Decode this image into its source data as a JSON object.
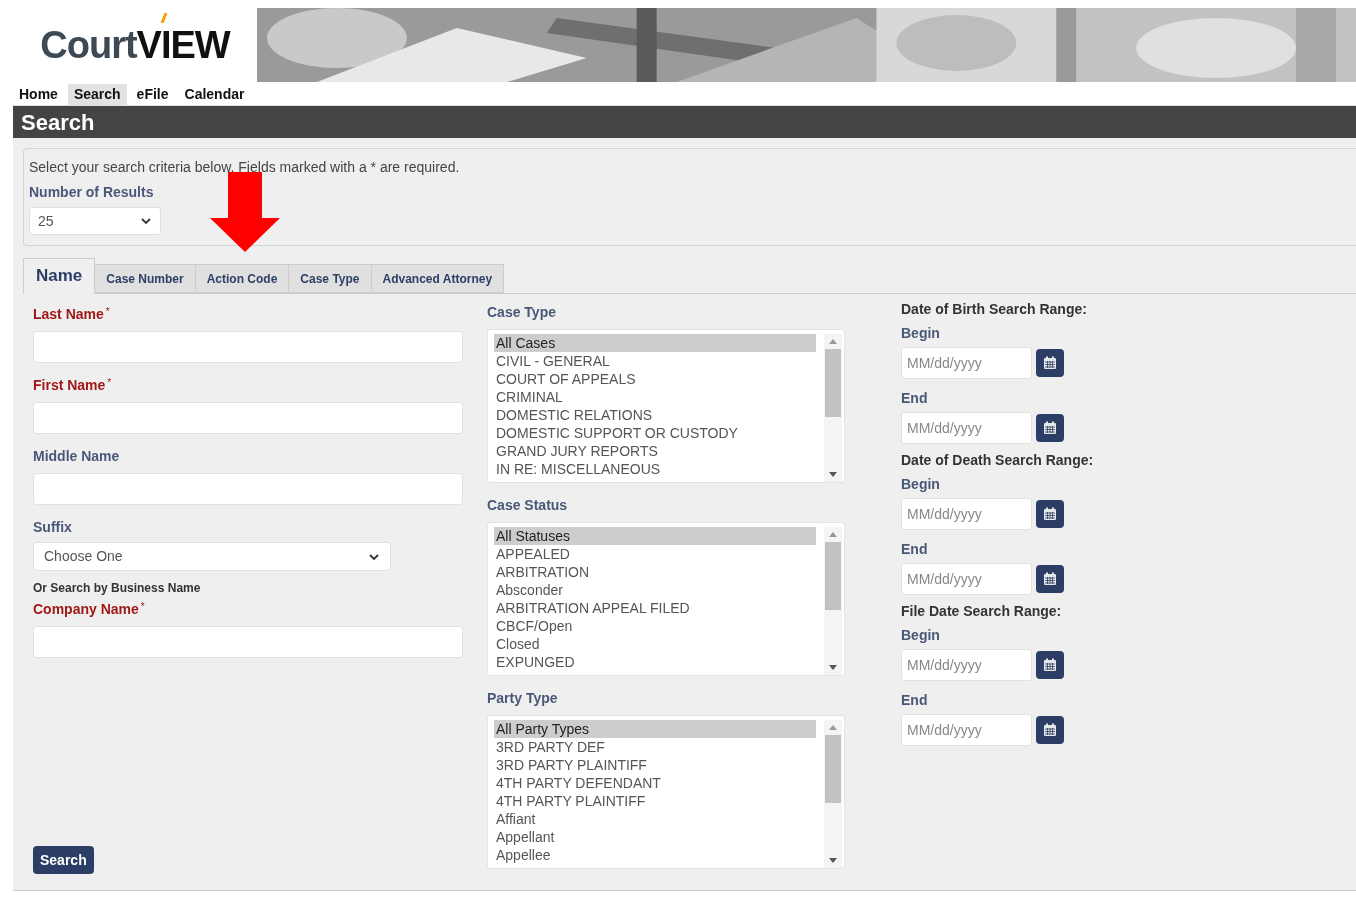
{
  "logo": {
    "text_start": "Court",
    "text_end": "VIEW"
  },
  "nav": [
    {
      "label": "Home",
      "selected": false
    },
    {
      "label": "Search",
      "selected": true
    },
    {
      "label": "eFile",
      "selected": false
    },
    {
      "label": "Calendar",
      "selected": false
    }
  ],
  "page_title": "Search",
  "instructions": "Select your search criteria below. Fields marked with a * are required.",
  "results": {
    "label": "Number of Results",
    "value": "25"
  },
  "tabs": [
    {
      "label": "Name",
      "selected": true
    },
    {
      "label": "Case Number",
      "selected": false
    },
    {
      "label": "Action Code",
      "selected": false
    },
    {
      "label": "Case Type",
      "selected": false
    },
    {
      "label": "Advanced Attorney",
      "selected": false
    }
  ],
  "name_form": [
    {
      "kind": "input",
      "label": "Last Name",
      "required": true,
      "mark": "*"
    },
    {
      "kind": "input",
      "label": "First Name",
      "required": true,
      "mark": "*"
    },
    {
      "kind": "input",
      "label": "Middle Name",
      "required": false
    },
    {
      "kind": "select",
      "label": "Suffix",
      "required": false,
      "value": "Choose One"
    },
    {
      "kind": "note",
      "label": "Or Search by Business Name"
    },
    {
      "kind": "input",
      "label": "Company Name",
      "required": true,
      "mark": "*"
    }
  ],
  "lists": [
    {
      "label": "Case Type",
      "items": [
        {
          "text": "All Cases",
          "selected": true
        },
        {
          "text": "CIVIL - GENERAL",
          "selected": false
        },
        {
          "text": "COURT OF APPEALS",
          "selected": false
        },
        {
          "text": "CRIMINAL",
          "selected": false
        },
        {
          "text": "DOMESTIC RELATIONS",
          "selected": false
        },
        {
          "text": "DOMESTIC SUPPORT OR CUSTODY",
          "selected": false
        },
        {
          "text": "GRAND JURY REPORTS",
          "selected": false
        },
        {
          "text": "IN RE: MISCELLANEOUS",
          "selected": false
        }
      ]
    },
    {
      "label": "Case Status",
      "items": [
        {
          "text": "All Statuses",
          "selected": true
        },
        {
          "text": "APPEALED",
          "selected": false
        },
        {
          "text": "ARBITRATION",
          "selected": false
        },
        {
          "text": "Absconder",
          "selected": false
        },
        {
          "text": "ARBITRATION APPEAL FILED",
          "selected": false
        },
        {
          "text": "CBCF/Open",
          "selected": false
        },
        {
          "text": "Closed",
          "selected": false
        },
        {
          "text": "EXPUNGED",
          "selected": false
        }
      ]
    },
    {
      "label": "Party Type",
      "items": [
        {
          "text": "All Party Types",
          "selected": true
        },
        {
          "text": "3RD PARTY DEF",
          "selected": false
        },
        {
          "text": "3RD PARTY PLAINTIFF",
          "selected": false
        },
        {
          "text": "4TH PARTY DEFENDANT",
          "selected": false
        },
        {
          "text": "4TH PARTY PLAINTIFF",
          "selected": false
        },
        {
          "text": "Affiant",
          "selected": false
        },
        {
          "text": "Appellant",
          "selected": false
        },
        {
          "text": "Appellee",
          "selected": false
        }
      ]
    }
  ],
  "date_ranges": [
    {
      "title": "Date of Birth Search Range:",
      "fields": [
        {
          "label": "Begin",
          "placeholder": "MM/dd/yyyy"
        },
        {
          "label": "End",
          "placeholder": "MM/dd/yyyy"
        }
      ]
    },
    {
      "title": "Date of Death Search Range:",
      "fields": [
        {
          "label": "Begin",
          "placeholder": "MM/dd/yyyy"
        },
        {
          "label": "End",
          "placeholder": "MM/dd/yyyy"
        }
      ]
    },
    {
      "title": "File Date Search Range:",
      "fields": [
        {
          "label": "Begin",
          "placeholder": "MM/dd/yyyy"
        },
        {
          "label": "End",
          "placeholder": "MM/dd/yyyy"
        }
      ]
    }
  ],
  "submit": "Search"
}
